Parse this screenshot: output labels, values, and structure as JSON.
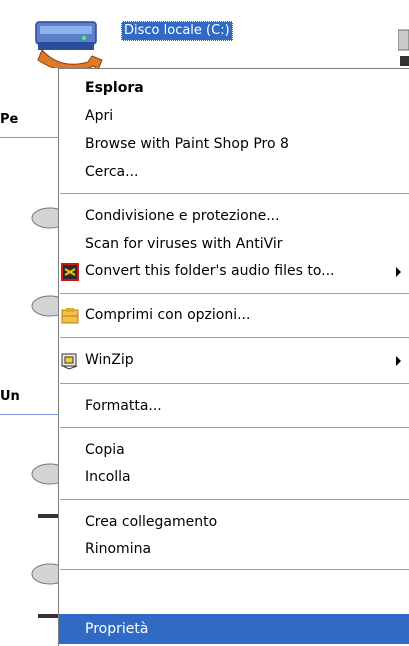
{
  "explorer": {
    "selected_drive_label": "Disco locale (C:)",
    "section_1_label": "Pe",
    "section_2_label": "Un"
  },
  "context_menu": {
    "items": [
      {
        "label": "Esplora",
        "bold": true
      },
      {
        "label": "Apri"
      },
      {
        "label": "Browse with Paint Shop Pro 8"
      },
      {
        "label": "Cerca..."
      },
      {
        "label": "Condivisione e protezione..."
      },
      {
        "label": "Scan for viruses with AntiVir"
      },
      {
        "label": "Convert this folder's audio files to...",
        "icon": "audio-convert-icon",
        "submenu": true
      },
      {
        "label": "Comprimi con opzioni...",
        "icon": "compress-icon"
      },
      {
        "label": "WinZip",
        "icon": "winzip-icon",
        "submenu": true
      },
      {
        "label": "Formatta..."
      },
      {
        "label": "Copia"
      },
      {
        "label": "Incolla"
      },
      {
        "label": "Crea collegamento"
      },
      {
        "label": "Rinomina"
      },
      {
        "label": "Proprietà",
        "selected": true
      }
    ]
  },
  "colors": {
    "selection": "#316ac5",
    "separator": "#a0a0a0",
    "section_line": "#7a96df"
  }
}
